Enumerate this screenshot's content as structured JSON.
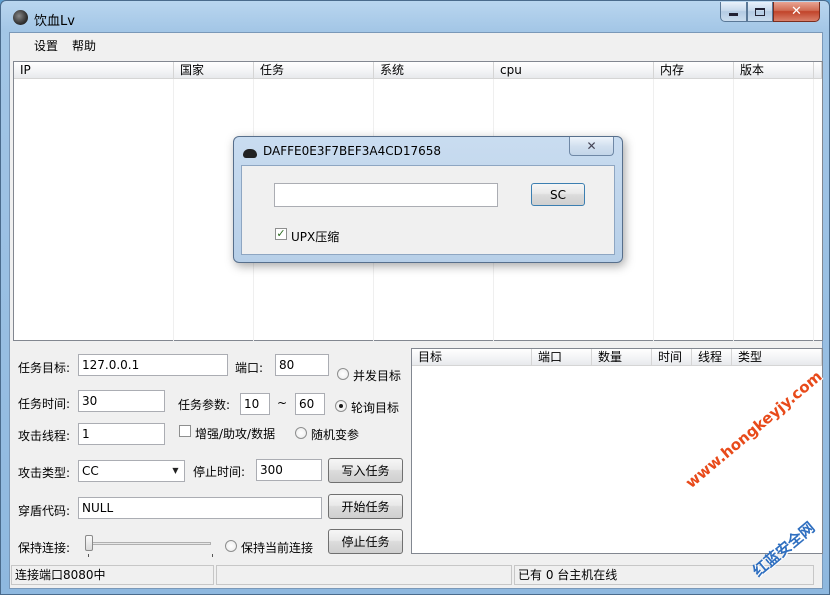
{
  "window": {
    "title": "饮血Lv",
    "minimize_glyph": "",
    "close_glyph": "✕"
  },
  "menu": {
    "items": [
      {
        "label": "设置"
      },
      {
        "label": "帮助"
      }
    ]
  },
  "main_list": {
    "columns": [
      "IP",
      "国家",
      "任务",
      "系统",
      "cpu",
      "内存",
      "版本"
    ]
  },
  "task_form": {
    "target_label": "任务目标:",
    "target_value": "127.0.0.1",
    "port_label": "端口:",
    "port_value": "80",
    "time_label": "任务时间:",
    "time_value": "30",
    "param_label": "任务参数:",
    "param_min": "10",
    "param_sep": "~",
    "param_max": "60",
    "threads_label": "攻击线程:",
    "threads_value": "1",
    "enhance_label": "增强/助攻/数据",
    "type_label": "攻击类型:",
    "type_value": "CC",
    "stop_time_label": "停止时间:",
    "stop_time_value": "300",
    "shield_label": "穿盾代码:",
    "shield_value": "NULL",
    "keep_label": "保持连接:",
    "radio_concurrent": "并发目标",
    "radio_poll": "轮询目标",
    "radio_random": "随机变参",
    "radio_keep_current": "保持当前连接",
    "btn_write": "写入任务",
    "btn_start": "开始任务",
    "btn_stop": "停止任务"
  },
  "task_list": {
    "columns": [
      "目标",
      "端口",
      "数量",
      "时间",
      "线程",
      "类型"
    ]
  },
  "statusbar": {
    "left": "连接端口8080中",
    "middle": "",
    "right": "已有 0 台主机在线"
  },
  "dialog": {
    "title": "DAFFE0E3F7BEF3A4CD17658",
    "close_glyph": "✕",
    "input_value": "",
    "sc_button": "SC",
    "upx_checkbox_label": "UPX压缩",
    "upx_checked_glyph": "✓"
  },
  "watermark": {
    "text1": "www.hongkeyjy.com",
    "text2": "红蓝安全网"
  },
  "colors": {
    "accent": "#4a6b8c",
    "watermark_red": "#e84a1a",
    "watermark_blue": "#2f6fc0"
  }
}
